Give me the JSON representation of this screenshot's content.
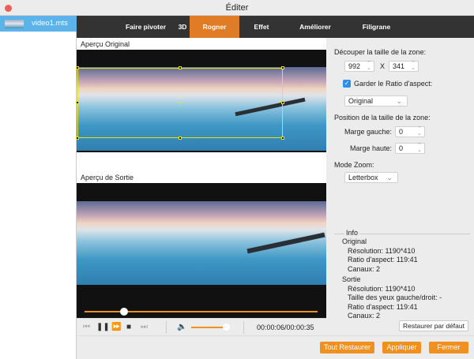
{
  "window": {
    "title": "Éditer"
  },
  "sidebar": {
    "items": [
      {
        "label": "video1.mts"
      }
    ]
  },
  "tabs": [
    {
      "label": "Faire pivoter"
    },
    {
      "label": "3D"
    },
    {
      "label": "Rogner",
      "active": true
    },
    {
      "label": "Effet"
    },
    {
      "label": "Améliorer"
    },
    {
      "label": "Filigrane"
    }
  ],
  "preview": {
    "original_label": "Aperçu Original",
    "output_label": "Aperçu de Sortie"
  },
  "player": {
    "time": "00:00:06/00:00:35",
    "progress": 0.17,
    "volume": 0.8
  },
  "crop": {
    "size_label": "Découper la taille de la zone:",
    "width": "992",
    "x_sep": "X",
    "height": "341",
    "keep_ratio_label": "Garder le Ratio d'aspect:",
    "keep_ratio": true,
    "ratio_value": "Original",
    "position_label": "Position de la taille de la zone:",
    "left_margin_label": "Marge gauche:",
    "left_margin": "0",
    "top_margin_label": "Marge haute:",
    "top_margin": "0",
    "zoom_mode_label": "Mode Zoom:",
    "zoom_mode": "Letterbox"
  },
  "info": {
    "title": "Info",
    "original_title": "Original",
    "original": [
      "Résolution: 1190*410",
      "Ratio d'aspect: 119:41",
      "Canaux: 2"
    ],
    "output_title": "Sortie",
    "output": [
      "Résolution: 1190*410",
      "Taille des yeux gauche/droit: -",
      "Ratio d'aspect: 119:41",
      "Canaux: 2"
    ]
  },
  "buttons": {
    "reset_default": "Restaurer par défaut",
    "reset_all": "Tout Restaurer",
    "apply": "Appliquer",
    "close": "Fermer"
  },
  "colors": {
    "accent": "#e07b26",
    "selection": "#5bb3ea",
    "crop": "#e6e600"
  }
}
